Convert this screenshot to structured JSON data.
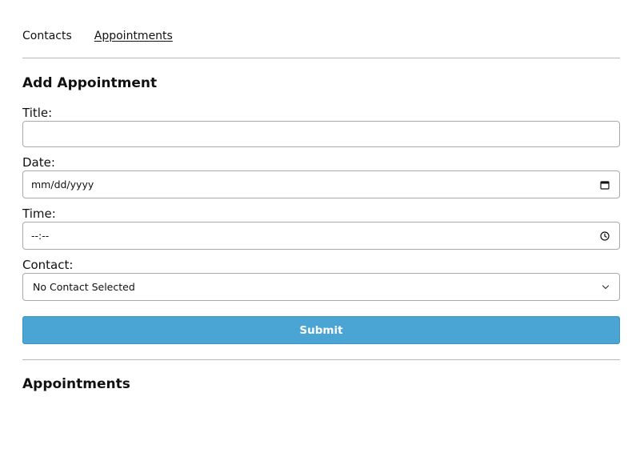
{
  "nav": {
    "links": [
      {
        "label": "Contacts"
      },
      {
        "label": "Appointments"
      }
    ]
  },
  "form": {
    "heading": "Add Appointment",
    "title_label": "Title:",
    "title_value": "",
    "date_label": "Date:",
    "date_value": "mm/dd/yyyy",
    "time_label": "Time:",
    "time_value": "--:--",
    "contact_label": "Contact:",
    "contact_selected": "No Contact Selected",
    "submit_label": "Submit"
  },
  "appointments": {
    "heading": "Appointments"
  },
  "icons": {
    "date": "calendar-icon",
    "time": "clock-icon",
    "select": "chevron-down-icon"
  },
  "colors": {
    "accent": "#4aa5d4",
    "divider": "#b8b8b8"
  }
}
